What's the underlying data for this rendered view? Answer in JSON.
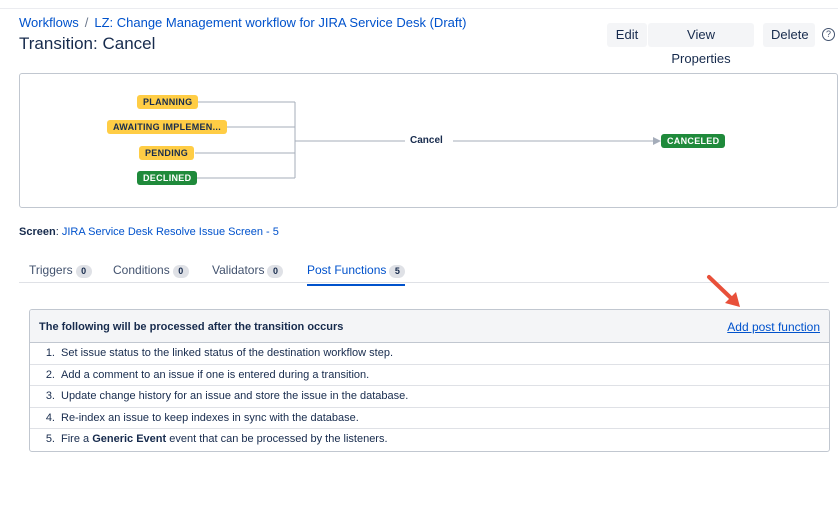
{
  "breadcrumb": {
    "root": "Workflows",
    "separator": "/",
    "workflow": "LZ: Change Management workflow for JIRA Service Desk (Draft)"
  },
  "title": "Transition: Cancel",
  "toolbar": {
    "edit_label": "Edit",
    "view_properties_label": "View Properties",
    "delete_label": "Delete",
    "help_glyph": "?"
  },
  "diagram": {
    "source_statuses": [
      {
        "label": "PLANNING",
        "color": "yellow"
      },
      {
        "label": "AWAITING IMPLEMEN...",
        "color": "yellow"
      },
      {
        "label": "PENDING",
        "color": "yellow"
      },
      {
        "label": "DECLINED",
        "color": "green"
      }
    ],
    "transition_label": "Cancel",
    "target_status": {
      "label": "CANCELED",
      "color": "green"
    }
  },
  "screen": {
    "label": "Screen",
    "value": "JIRA Service Desk Resolve Issue Screen - 5"
  },
  "tabs": [
    {
      "label": "Triggers",
      "count": "0",
      "active": false
    },
    {
      "label": "Conditions",
      "count": "0",
      "active": false
    },
    {
      "label": "Validators",
      "count": "0",
      "active": false
    },
    {
      "label": "Post Functions",
      "count": "5",
      "active": true
    }
  ],
  "post_functions": {
    "header": "The following will be processed after the transition occurs",
    "add_label": "Add post function",
    "items": [
      {
        "num": "1.",
        "text": "Set issue status to the linked status of the destination workflow step."
      },
      {
        "num": "2.",
        "text": "Add a comment to an issue if one is entered during a transition."
      },
      {
        "num": "3.",
        "text": "Update change history for an issue and store the issue in the database."
      },
      {
        "num": "4.",
        "text": "Re-index an issue to keep indexes in sync with the database."
      },
      {
        "num": "5.",
        "pre": "Fire a ",
        "bold": "Generic Event",
        "post": " event that can be processed by the listeners."
      }
    ]
  },
  "colors": {
    "link": "#0052cc",
    "status_yellow": "#ffcd45",
    "status_green": "#1f8a3b",
    "annotation_arrow": "#e8503a"
  }
}
